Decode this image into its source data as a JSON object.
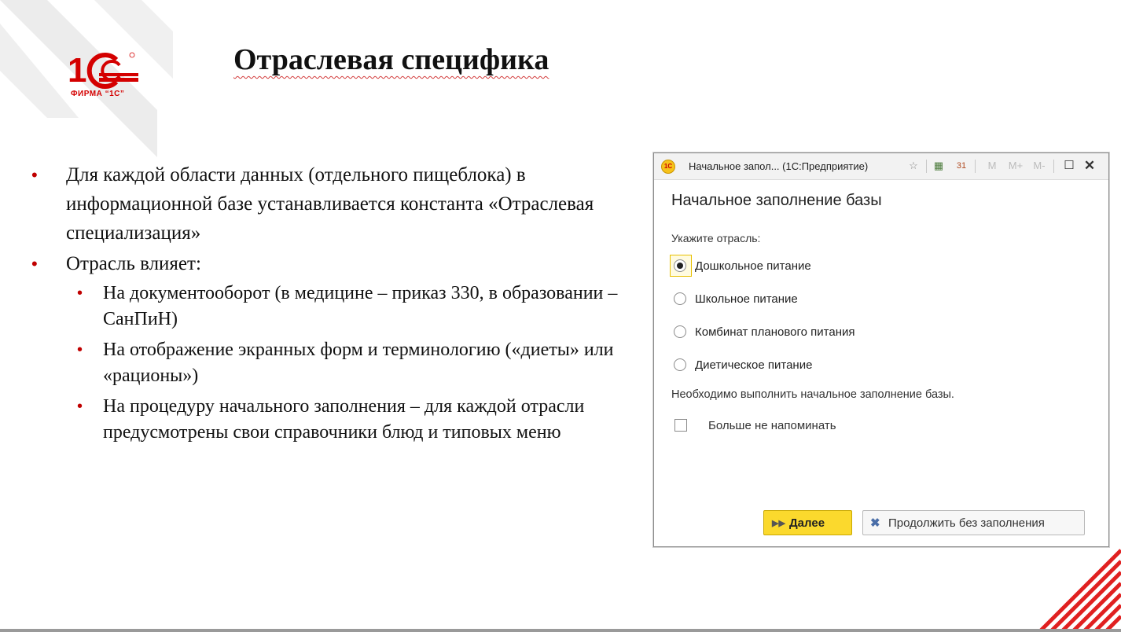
{
  "slide": {
    "title": "Отраслевая специфика",
    "bullets": [
      "Для каждой области данных (отдельного пищеблока) в информационной базе устанавливается константа «Отраслевая специализация»",
      "Отрасль влияет:"
    ],
    "sub_bullets": [
      "На документооборот (в медицине – приказ 330, в образовании – СанПиН)",
      "На отображение экранных форм и терминологию («диеты» или «рационы»)",
      "На процедуру начального заполнения – для каждой отрасли предусмотрены свои справочники блюд и типовых меню"
    ]
  },
  "logo": {
    "caption": "ФИРМА “1С”",
    "brand_color": "#d40000"
  },
  "window": {
    "title": "Начальное запол... (1С:Предприятие)",
    "icon": "1c-logo-icon",
    "toolbar": [
      "favorite-star-icon",
      "calculator-icon",
      "calendar-icon",
      "M",
      "M+",
      "M-",
      "maximize-icon",
      "close-icon"
    ],
    "form_title": "Начальное заполнение базы",
    "prompt": "Укажите отрасль:",
    "options": [
      {
        "label": "Дошкольное питание",
        "selected": true
      },
      {
        "label": "Школьное питание",
        "selected": false
      },
      {
        "label": "Комбинат планового питания",
        "selected": false
      },
      {
        "label": "Диетическое питание",
        "selected": false
      }
    ],
    "notice": "Необходимо выполнить начальное заполнение базы.",
    "checkbox": {
      "label": "Больше не напоминать",
      "checked": false
    },
    "buttons": {
      "next": "Далее",
      "skip": "Продолжить без заполнения"
    },
    "accent_color": "#fbd92d"
  }
}
